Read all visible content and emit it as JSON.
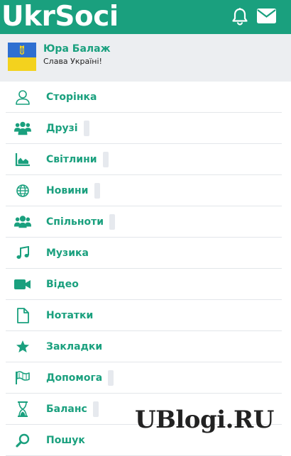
{
  "header": {
    "logo_text": "UkrSoci",
    "icons": [
      "bell-icon",
      "envelope-icon"
    ],
    "background": "#1aa07e"
  },
  "profile": {
    "name": "Юра Балаж",
    "status": "Слава Україні!",
    "avatar": "ukraine-flag-coat-of-arms"
  },
  "menu": {
    "items": [
      {
        "label": "Сторінка",
        "icon": "user-icon",
        "has_counter": false
      },
      {
        "label": "Друзі",
        "icon": "users-icon",
        "has_counter": true
      },
      {
        "label": "Світлини",
        "icon": "area-chart-icon",
        "has_counter": true
      },
      {
        "label": "Новини",
        "icon": "globe-icon",
        "has_counter": true
      },
      {
        "label": "Спільноти",
        "icon": "group-icon",
        "has_counter": true
      },
      {
        "label": "Музика",
        "icon": "music-icon",
        "has_counter": false
      },
      {
        "label": "Відео",
        "icon": "video-camera-icon",
        "has_counter": false
      },
      {
        "label": "Нотатки",
        "icon": "document-icon",
        "has_counter": false
      },
      {
        "label": "Закладки",
        "icon": "star-icon",
        "has_counter": false
      },
      {
        "label": "Допомога",
        "icon": "flag-icon",
        "has_counter": true
      },
      {
        "label": "Баланс",
        "icon": "hourglass-icon",
        "has_counter": true
      },
      {
        "label": "Пошук",
        "icon": "search-icon",
        "has_counter": false
      }
    ]
  },
  "watermark": {
    "text": "UBlogi.RU"
  },
  "colors": {
    "accent": "#1aa07e",
    "profile_bg": "#eceef1",
    "divider": "#e3e6ea",
    "counter_bg": "#e6e9ee"
  }
}
